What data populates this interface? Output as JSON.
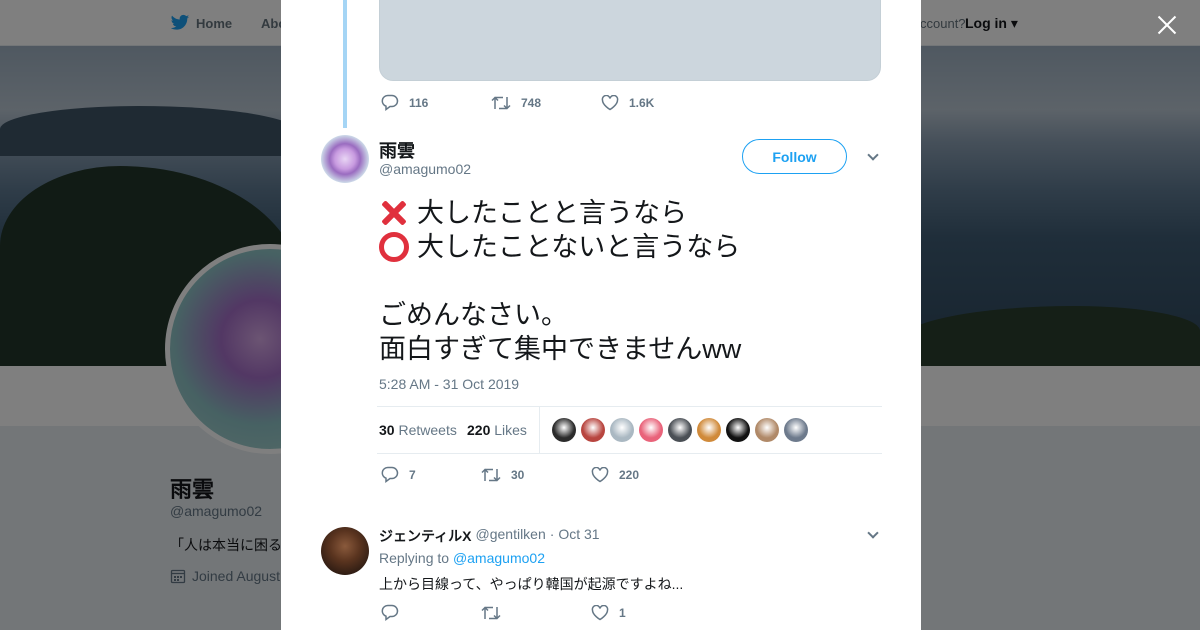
{
  "nav": {
    "home_label": "Home",
    "about_label": "Abo",
    "account_text": "ccount?",
    "login_label": "Log in"
  },
  "profile": {
    "name": "雨雲",
    "handle": "@amagumo02",
    "bio_snippet": "「人は本当に困る",
    "joined_snippet": "Joined August"
  },
  "previous_tweet": {
    "replies": "116",
    "retweets": "748",
    "likes": "1.6K"
  },
  "tweet": {
    "author_name": "雨雲",
    "author_handle": "@amagumo02",
    "follow_label": "Follow",
    "line1": "大したことと言うなら",
    "line2": "大したことないと言うなら",
    "line3": "ごめんなさい。",
    "line4": "面白すぎて集中できませんww",
    "timestamp": "5:28 AM - 31 Oct 2019",
    "retweet_count": "30",
    "retweets_label": "Retweets",
    "like_count": "220",
    "likes_label": "Likes",
    "actions": {
      "replies": "7",
      "retweets": "30",
      "likes": "220"
    },
    "liker_colors": [
      "#2b2b2b",
      "#b8453f",
      "#aab8c2",
      "#e9637a",
      "#4a4f55",
      "#d08a3a",
      "#111111",
      "#b08968",
      "#6d7a8c"
    ]
  },
  "reply": {
    "author_name": "ジェンティルX",
    "author_handle": "@gentilken",
    "date": "· Oct 31",
    "replying_prefix": "Replying to",
    "replying_to": "@amagumo02",
    "text": "上から目線って、やっぱり韓国が起源ですよね...",
    "actions": {
      "replies": "",
      "retweets": "",
      "likes": "1"
    }
  },
  "colors": {
    "accent": "#1da1f2",
    "mark_red": "#e0303d",
    "secondary_text": "#657786"
  }
}
